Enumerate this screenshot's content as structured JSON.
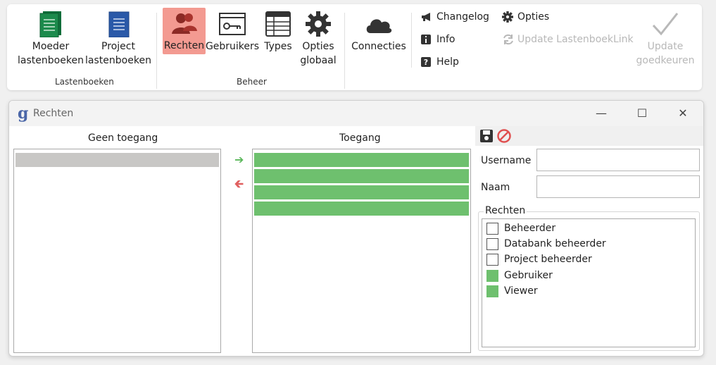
{
  "ribbon": {
    "lastenboeken": {
      "group_label": "Lastenboeken",
      "moeder": {
        "label": "Moeder\nlastenboeken",
        "icon": "green-book-icon"
      },
      "project": {
        "label": "Project\nlastenboeken",
        "icon": "blue-book-icon"
      }
    },
    "beheer": {
      "group_label": "Beheer",
      "rechten": {
        "label": "Rechten",
        "icon": "users-icon"
      },
      "gebruikers": {
        "label": "Gebruikers",
        "icon": "user-key-icon"
      },
      "types": {
        "label": "Types",
        "icon": "table-icon"
      },
      "opties_globaal": {
        "label": "Opties\nglobaal",
        "icon": "gear-icon"
      }
    },
    "connecties": {
      "label": "Connecties",
      "icon": "cloud-icon"
    },
    "changelog": {
      "label": "Changelog",
      "icon": "megaphone-icon"
    },
    "info": {
      "label": "Info",
      "icon": "info-icon"
    },
    "help": {
      "label": "Help",
      "icon": "help-icon"
    },
    "opties": {
      "label": "Opties",
      "icon": "gear-icon"
    },
    "update_link": {
      "label": "Update LastenboekLink",
      "icon": "refresh-icon"
    },
    "update_goedkeuren": {
      "label": "Update\ngoedkeuren",
      "icon": "checkmark-icon"
    }
  },
  "window": {
    "title": "Rechten",
    "logo": "g",
    "controls": {
      "minimize": "—",
      "maximize": "☐",
      "close": "✕"
    }
  },
  "geen_toegang": {
    "header": "Geen toegang",
    "items": [
      {
        "state": "selected"
      }
    ]
  },
  "toegang": {
    "header": "Toegang",
    "items": [
      {
        "state": "granted"
      },
      {
        "state": "granted"
      },
      {
        "state": "granted"
      },
      {
        "state": "granted"
      }
    ]
  },
  "arrows": {
    "to_right": "➔",
    "to_left": "🡰"
  },
  "form": {
    "username_label": "Username",
    "username_value": "",
    "naam_label": "Naam",
    "naam_value": ""
  },
  "rechten_group": {
    "title": "Rechten",
    "items": [
      {
        "label": "Beheerder",
        "checked": false
      },
      {
        "label": "Databank beheerder",
        "checked": false
      },
      {
        "label": "Project beheerder",
        "checked": false
      },
      {
        "label": "Gebruiker",
        "checked": true
      },
      {
        "label": "Viewer",
        "checked": true
      }
    ]
  },
  "colors": {
    "active_tab": "#f39a91",
    "granted": "#6ec06e",
    "selected_item": "#c8c7c5",
    "arrow_right": "#5cb85c",
    "arrow_left": "#e06060",
    "cancel": "#e05050"
  }
}
